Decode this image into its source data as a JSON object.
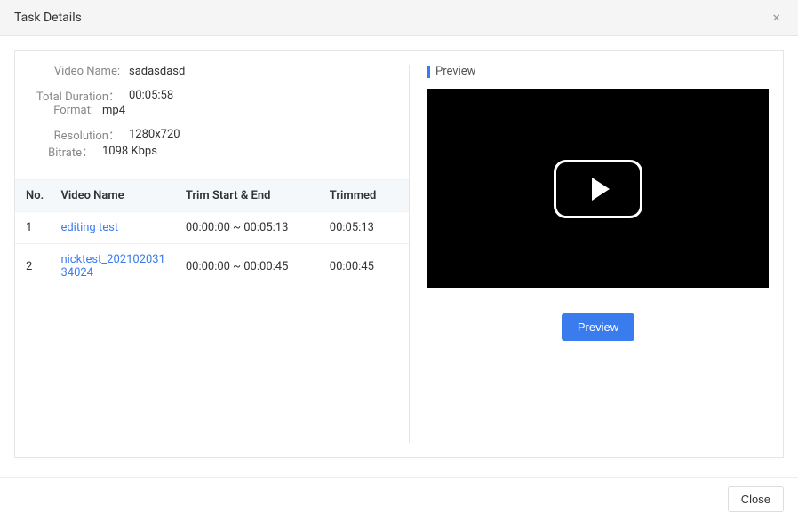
{
  "header": {
    "title": "Task Details",
    "close_icon": "×"
  },
  "details": {
    "labels": {
      "video_name": "Video Name:",
      "total_duration": "Total Duration：",
      "format": "Format:",
      "resolution": "Resolution：",
      "bitrate": "Bitrate："
    },
    "values": {
      "video_name": "sadasdasd",
      "total_duration": "00:05:58",
      "format": "mp4",
      "resolution": "1280x720",
      "bitrate": "1098 Kbps"
    }
  },
  "table": {
    "columns": {
      "no": "No.",
      "video_name": "Video Name",
      "trim": "Trim Start & End",
      "trimmed": "Trimmed"
    },
    "rows": [
      {
        "no": "1",
        "name": "editing test",
        "trim": "00:00:00 ~ 00:05:13",
        "trimmed": "00:05:13"
      },
      {
        "no": "2",
        "name": "nicktest_20210203134024",
        "trim": "00:00:00 ~ 00:00:45",
        "trimmed": "00:00:45"
      }
    ]
  },
  "preview": {
    "title": "Preview",
    "button": "Preview"
  },
  "footer": {
    "close": "Close"
  }
}
